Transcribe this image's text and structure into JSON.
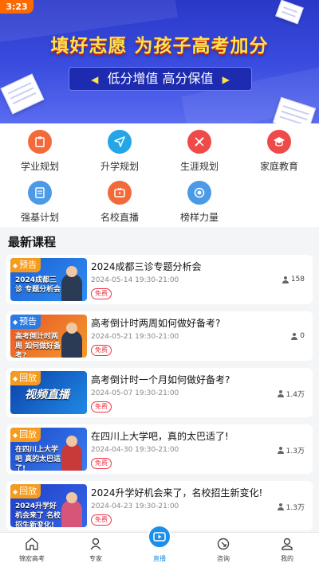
{
  "status_bar": {
    "time": "3:23"
  },
  "banner": {
    "title": "填好志愿 为孩子高考加分",
    "slogan": "低分增值 高分保值",
    "left_arrow": "◀",
    "right_arrow": "▶"
  },
  "quick_menu": [
    {
      "label": "学业规划",
      "icon": "clipboard-icon",
      "color": "#f26a3a"
    },
    {
      "label": "升学规划",
      "icon": "send-icon",
      "color": "#24a6e6"
    },
    {
      "label": "生涯规划",
      "icon": "pencil-ruler-icon",
      "color": "#ef4a4a"
    },
    {
      "label": "家庭教育",
      "icon": "graduation-cap-icon",
      "color": "#ef4a4a"
    },
    {
      "label": "强基计划",
      "icon": "document-icon",
      "color": "#4a9ae8"
    },
    {
      "label": "名校直播",
      "icon": "tv-icon",
      "color": "#f26a3a"
    },
    {
      "label": "榜样力量",
      "icon": "target-icon",
      "color": "#4a9ae8"
    }
  ],
  "section": {
    "title": "最新课程"
  },
  "courses": [
    {
      "tag": "预告",
      "thumb_text": "2024成都三诊 专题分析会",
      "title": "2024成都三诊专题分析会",
      "date": "2024-05-14 19:30-21:00",
      "price": "免费",
      "views": "158"
    },
    {
      "tag": "预告",
      "thumb_text": "高考倒计时两周 如何做好备考?",
      "title": "高考倒计时两周如何做好备考?",
      "date": "2024-05-21 19:30-21:00",
      "price": "免费",
      "views": "0"
    },
    {
      "tag": "回放",
      "thumb_text": "视频直播",
      "title": "高考倒计时一个月如何做好备考?",
      "date": "2024-05-07 19:30-21:00",
      "price": "免费",
      "views": "1.4万"
    },
    {
      "tag": "回放",
      "thumb_text": "在四川上大学吧 真的太巴适了!",
      "title": "在四川上大学吧，真的太巴适了!",
      "date": "2024-04-30 19:30-21:00",
      "price": "免费",
      "views": "1.3万"
    },
    {
      "tag": "回放",
      "thumb_text": "2024升学好机会来了 名校招生新变化!",
      "title": "2024升学好机会来了，名校招生新变化!",
      "date": "2024-04-23 19:30-21:00",
      "price": "免费",
      "views": "1.3万"
    }
  ],
  "tabbar": [
    {
      "label": "锦宏高考",
      "icon": "home-icon"
    },
    {
      "label": "专家",
      "icon": "person-icon"
    },
    {
      "label": "直播",
      "icon": "live-play-icon",
      "active": true
    },
    {
      "label": "咨询",
      "icon": "consult-icon"
    },
    {
      "label": "我的",
      "icon": "profile-icon"
    }
  ],
  "colors": {
    "accent": "#1e8fe8",
    "banner": "#2a38c8",
    "highlight": "#ffe24a",
    "free": "#e34444"
  }
}
